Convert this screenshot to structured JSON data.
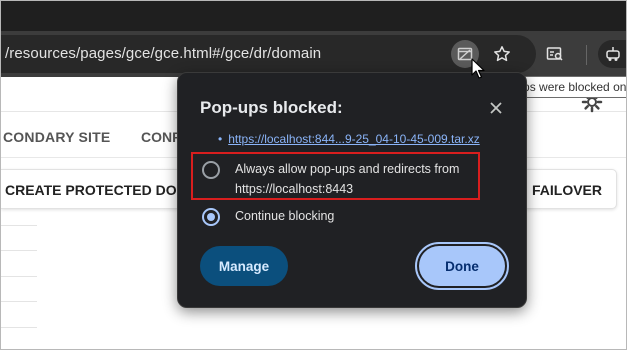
{
  "browser": {
    "url": "/resources/pages/gce/gce.html#/gce/dr/domain",
    "tooltip": "Pop-ups were blocked on this page"
  },
  "page": {
    "tabs": [
      {
        "label": "CONDARY SITE"
      },
      {
        "label": "CONF"
      }
    ],
    "buttons": {
      "create_label": "CREATE PROTECTED DO",
      "failover_label": "FAILOVER"
    }
  },
  "popup_dialog": {
    "title": "Pop-ups blocked:",
    "blocked_link": "https://localhost:844...9-25_04-10-45-009.tar.xz",
    "bullet": "•",
    "option_allow": "Always allow pop-ups and redirects from https://localhost:8443",
    "option_continue": "Continue blocking",
    "selected_option": "Continue blocking",
    "manage_label": "Manage",
    "done_label": "Done"
  },
  "colors": {
    "toolbar_bg": "#3c3c3c",
    "dialog_bg": "#202124",
    "accent_blue": "#a8c7fa",
    "manage_bg": "#0b4f7d",
    "highlight_red": "#d81e1e"
  },
  "icons": [
    "popup-blocked-icon",
    "star-icon",
    "reading-mode-icon",
    "extension-icon",
    "close-icon",
    "gear-icon",
    "cursor-icon"
  ]
}
